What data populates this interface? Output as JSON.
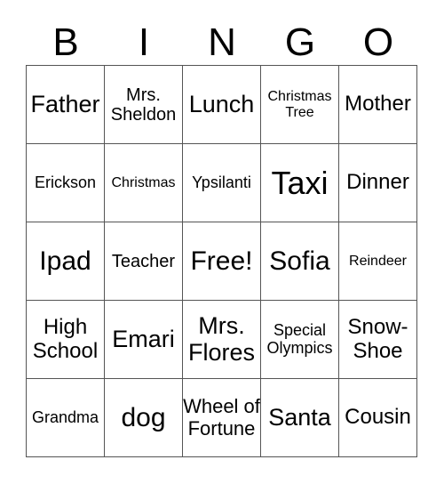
{
  "header": [
    "B",
    "I",
    "N",
    "G",
    "O"
  ],
  "cells": [
    [
      "Father",
      "Mrs. Sheldon",
      "Lunch",
      "Christmas Tree",
      "Mother"
    ],
    [
      "Erickson",
      "Christmas",
      "Ypsilanti",
      "Taxi",
      "Dinner"
    ],
    [
      "Ipad",
      "Teacher",
      "Free!",
      "Sofia",
      "Reindeer"
    ],
    [
      "High School",
      "Emari",
      "Mrs. Flores",
      "Special Olympics",
      "Snow-Shoe"
    ],
    [
      "Grandma",
      "dog",
      "Wheel of Fortune",
      "Santa",
      "Cousin"
    ]
  ]
}
